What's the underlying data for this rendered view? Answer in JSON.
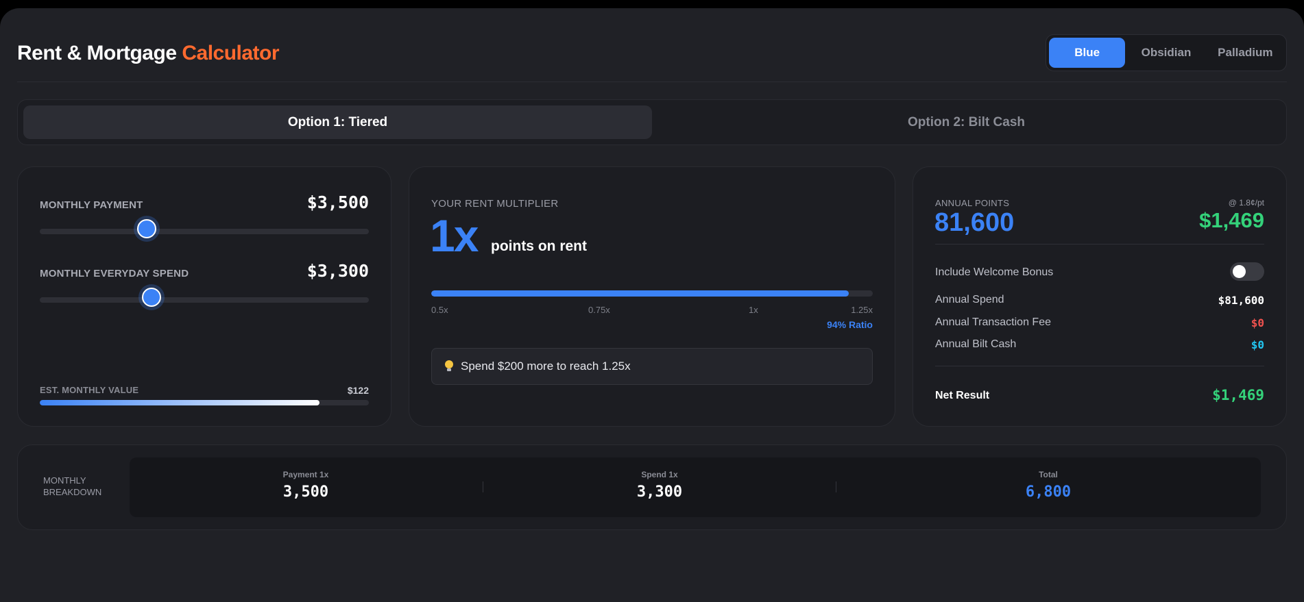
{
  "header": {
    "title_main": "Rent & Mortgage",
    "title_accent": "Calculator",
    "card_options": [
      {
        "label": "Blue",
        "active": true
      },
      {
        "label": "Obsidian",
        "active": false
      },
      {
        "label": "Palladium",
        "active": false
      }
    ]
  },
  "tabs": [
    {
      "label": "Option 1: Tiered",
      "active": true
    },
    {
      "label": "Option 2: Bilt Cash",
      "active": false
    }
  ],
  "inputs": {
    "monthly_payment": {
      "label": "MONTHLY PAYMENT",
      "value": "$3,500",
      "slider_fraction": 0.325
    },
    "monthly_spend": {
      "label": "MONTHLY EVERYDAY SPEND",
      "value": "$3,300",
      "slider_fraction": 0.339
    },
    "est_monthly_value": {
      "label": "EST. MONTHLY VALUE",
      "value": "$122",
      "fill_fraction": 0.85
    }
  },
  "multiplier": {
    "label": "YOUR RENT MULTIPLIER",
    "value": "1x",
    "subtitle": "points on rent",
    "ratio_fraction": 0.945,
    "ticks": [
      "0.5x",
      "0.75x",
      "1x",
      "1.25x"
    ],
    "ratio_label": "94% Ratio",
    "tip": "Spend $200 more to reach 1.25x"
  },
  "points": {
    "label": "ANNUAL POINTS",
    "value": "81,600",
    "rate_label": "@ 1.8¢/pt",
    "rate_value": "$1,469",
    "welcome_bonus_label": "Include Welcome Bonus",
    "welcome_bonus_on": false,
    "line_items": [
      {
        "label": "Annual Spend",
        "value": "$81,600",
        "color": "#ffffff"
      },
      {
        "label": "Annual Transaction Fee",
        "value": "$0",
        "color": "#f0524f"
      },
      {
        "label": "Annual Bilt Cash",
        "value": "$0",
        "color": "#22c5f0"
      }
    ],
    "net_label": "Net Result",
    "net_value": "$1,469"
  },
  "breakdown": {
    "label_line1": "MONTHLY",
    "label_line2": "BREAKDOWN",
    "items": [
      {
        "label": "Payment 1x",
        "value": "3,500"
      },
      {
        "label": "Spend 1x",
        "value": "3,300"
      },
      {
        "label": "Total",
        "value": "6,800"
      }
    ]
  },
  "colors": {
    "accent_blue": "#3b82f6",
    "accent_orange": "#ff6a2f",
    "positive_green": "#34d27a",
    "negative_red": "#f0524f",
    "cyan": "#22c5f0"
  }
}
